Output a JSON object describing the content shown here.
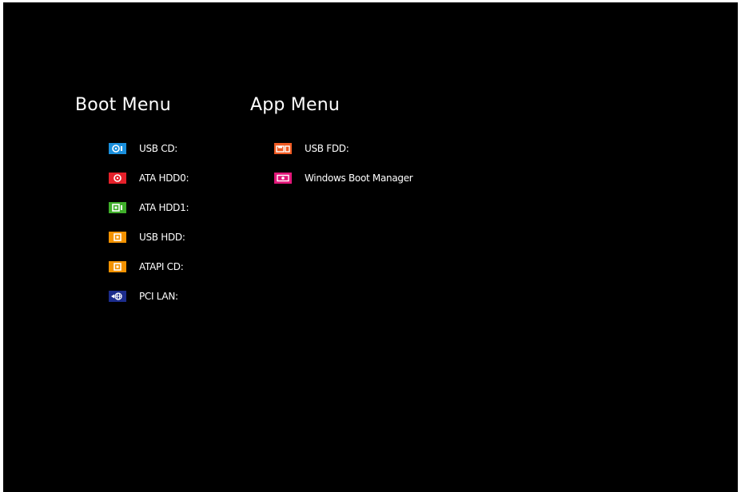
{
  "boot_menu": {
    "title": "Boot Menu",
    "items": [
      {
        "label": "USB CD:",
        "icon": "usb-cd-icon",
        "color": "#1a8fdc"
      },
      {
        "label": "ATA HDD0:",
        "icon": "hdd-icon",
        "color": "#e5202a"
      },
      {
        "label": "ATA HDD1:",
        "icon": "hdd-icon",
        "color": "#3fae2a"
      },
      {
        "label": "USB HDD:",
        "icon": "usb-hdd-icon",
        "color": "#f39200"
      },
      {
        "label": "ATAPI CD:",
        "icon": "cd-icon",
        "color": "#f39200"
      },
      {
        "label": "PCI LAN:",
        "icon": "network-icon",
        "color": "#1c2c8c"
      }
    ]
  },
  "app_menu": {
    "title": "App Menu",
    "items": [
      {
        "label": "USB FDD:",
        "icon": "floppy-icon",
        "color": "#f05a22"
      },
      {
        "label": "Windows Boot Manager",
        "icon": "boot-manager-icon",
        "color": "#e2177a"
      }
    ]
  }
}
